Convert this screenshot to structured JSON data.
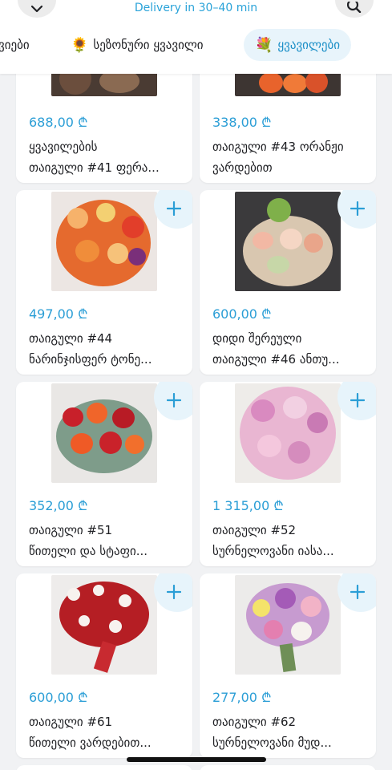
{
  "header": {
    "delivery_text": "Delivery in 30–40 min",
    "back_icon": "chevron-down-icon",
    "search_icon": "search-icon"
  },
  "categories": [
    {
      "label": "ვიები",
      "emoji": "",
      "selected": false
    },
    {
      "label": "სეზონური ყვავილი",
      "emoji": "🌻",
      "selected": false
    },
    {
      "label": "ყვავილები",
      "emoji": "💐",
      "selected": true
    }
  ],
  "products": [
    {
      "price": "688,00 ₾",
      "name_line1": "ყვავილების",
      "name_line2": "თაიგული #41 ფერა...",
      "has_plus": false
    },
    {
      "price": "338,00 ₾",
      "name_line1": "თაიგული #43 ორანჟი",
      "name_line2": "ვარდებით",
      "has_plus": false
    },
    {
      "price": "497,00 ₾",
      "name_line1": "თაიგული #44",
      "name_line2": "ნარინჯისფერ ტონე...",
      "has_plus": true
    },
    {
      "price": "600,00 ₾",
      "name_line1": "დიდი შერეული",
      "name_line2": "თაიგული #46 ანთუ...",
      "has_plus": true
    },
    {
      "price": "352,00 ₾",
      "name_line1": "თაიგული #51",
      "name_line2": "წითელი და სტაფი...",
      "has_plus": true
    },
    {
      "price": "1 315,00 ₾",
      "name_line1": "თაიგული #52",
      "name_line2": "სურნელოვანი იასა...",
      "has_plus": true
    },
    {
      "price": "600,00 ₾",
      "name_line1": "თაიგული #61",
      "name_line2": "წითელი ვარდებით...",
      "has_plus": true
    },
    {
      "price": "277,00 ₾",
      "name_line1": "თაიგული #62",
      "name_line2": "სურნელოვანი მუდ...",
      "has_plus": true
    }
  ],
  "colors": {
    "accent": "#2b9ed6",
    "plus_bg": "#e7f4fb",
    "selected_chip_bg": "#e8f4fb"
  }
}
